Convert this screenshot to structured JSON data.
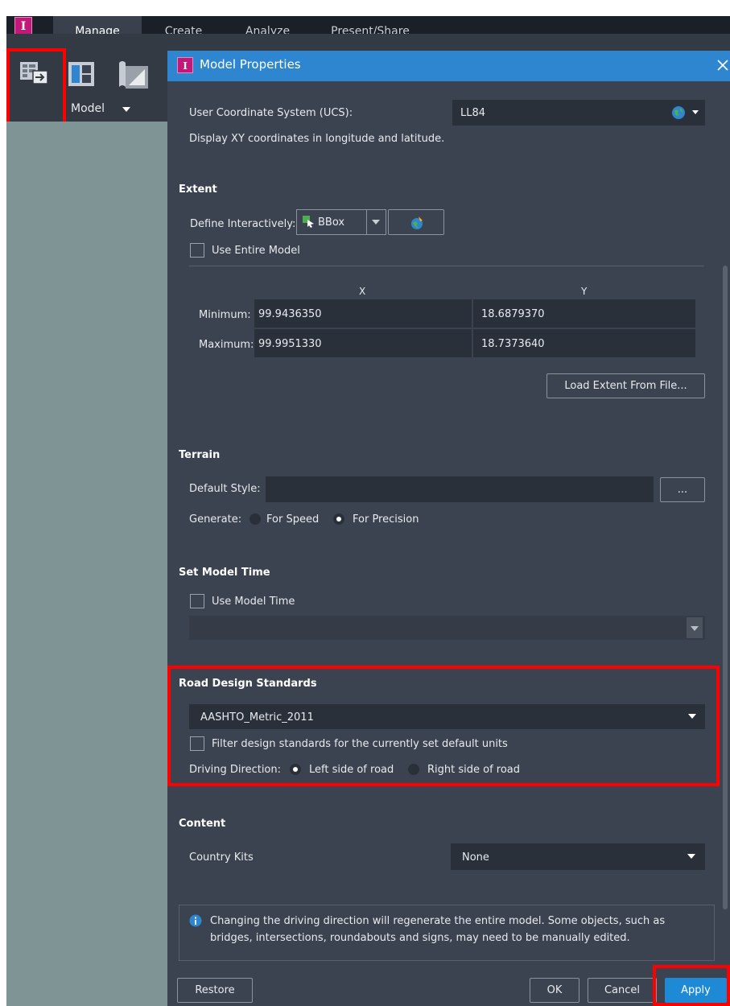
{
  "app": {
    "icon_letter": "I",
    "tabs": [
      "Manage",
      "Create",
      "Analyze",
      "Present/Share"
    ],
    "ribbon": {
      "model_label": "Model"
    }
  },
  "dialog": {
    "title": "Model Properties",
    "ucs": {
      "label": "User Coordinate System (UCS):",
      "value": "LL84",
      "description": "Display XY coordinates in longitude and latitude."
    },
    "extent": {
      "header": "Extent",
      "define_label": "Define Interactively:",
      "define_value": "BBox",
      "use_entire_model": "Use Entire Model",
      "col_x": "X",
      "col_y": "Y",
      "min_label": "Minimum:",
      "max_label": "Maximum:",
      "min_x": "99.9436350",
      "min_y": "18.6879370",
      "max_x": "99.9951330",
      "max_y": "18.7373640",
      "load_button": "Load Extent From File..."
    },
    "terrain": {
      "header": "Terrain",
      "default_style_label": "Default Style:",
      "default_style_value": "",
      "browse_button": "...",
      "generate_label": "Generate:",
      "for_speed": "For Speed",
      "for_precision": "For Precision",
      "selected": "For Precision"
    },
    "model_time": {
      "header": "Set Model Time",
      "use_model_time": "Use Model Time",
      "time_value": ""
    },
    "road_design": {
      "header": "Road Design Standards",
      "standard_value": "AASHTO_Metric_2011",
      "filter_label": "Filter design standards for the currently set default units",
      "driving_direction_label": "Driving Direction:",
      "left_side": "Left side of road",
      "right_side": "Right side of road",
      "selected": "Left side of road"
    },
    "content": {
      "header": "Content",
      "country_kits_label": "Country Kits",
      "country_kits_value": "None"
    },
    "info_message_line1": "Changing the driving direction will regenerate the entire model. Some objects, such as",
    "info_message_line2": "bridges, intersections, roundabouts and signs, may need to be manually edited.",
    "buttons": {
      "restore": "Restore",
      "ok": "OK",
      "cancel": "Cancel",
      "apply": "Apply"
    }
  },
  "colors": {
    "dialog_bg": "#3b4351",
    "title_bar": "#2e86d1",
    "apply_button": "#1e8ad6",
    "highlight_box": "#ff0000",
    "app_icon": "#c2187a"
  },
  "icons": [
    "app-logo-icon",
    "model-properties-icon",
    "layout-icon",
    "terrain-model-icon",
    "globe-icon",
    "bbox-cursor-icon",
    "map-pick-icon",
    "info-icon",
    "close-icon"
  ]
}
